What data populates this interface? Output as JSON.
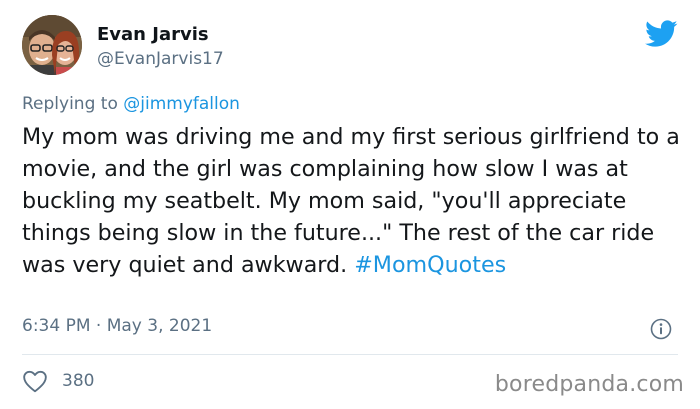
{
  "author": {
    "name": "Evan Jarvis",
    "handle": "@EvanJarvis17"
  },
  "reply": {
    "prefix": "Replying to ",
    "mention": "@jimmyfallon"
  },
  "tweet": {
    "text": "My mom was driving me and my first serious girlfriend to a movie, and the girl was complaining how slow I was at buckling my seatbelt. My mom said, \"you'll appreciate things being slow in the future...\" The rest of the car ride was very quiet and awkward. ",
    "hashtag": "#MomQuotes",
    "time": "6:34 PM",
    "separator": " · ",
    "date": "May 3, 2021"
  },
  "stats": {
    "likes": "380"
  },
  "watermark": "boredpanda.com",
  "colors": {
    "accent": "#1b95e0",
    "twitter_blue": "#1da1f2",
    "muted": "#5b7083"
  },
  "icons": {
    "brand": "twitter-bird-icon",
    "info": "info-icon",
    "like": "heart-icon"
  }
}
